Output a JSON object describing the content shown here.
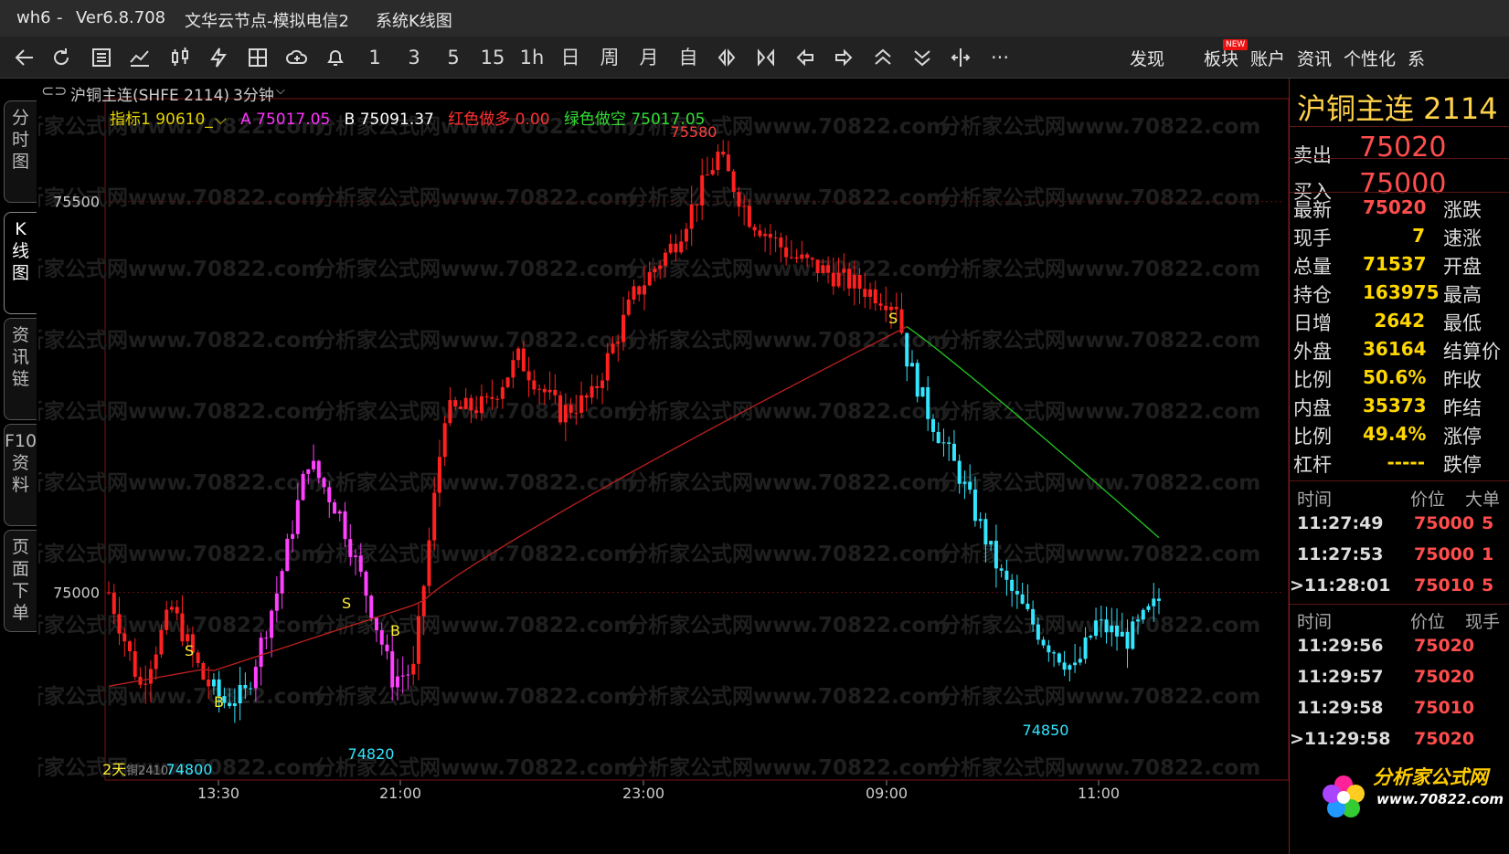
{
  "titlebar": {
    "app": "wh6",
    "separator": "-",
    "version": "Ver6.8.708",
    "server": "文华云节点-模拟电信2",
    "view": "系统K线图"
  },
  "toolbar": {
    "periods": [
      "1",
      "3",
      "5",
      "15",
      "1h",
      "日",
      "周",
      "月",
      "自"
    ],
    "discover": "发现",
    "new_badge": "NEW",
    "sector": "板块",
    "account": "账户",
    "news": "资讯",
    "personalize": "个性化",
    "system": "系"
  },
  "lefttabs": {
    "timeshare": "分时图",
    "kline": "K线图",
    "newschain": "资讯链",
    "f10": "F10资料",
    "pagedown": "页面下单"
  },
  "chart_header": {
    "contract": "沪铜主连(SHFE 2114)",
    "period": "3分钟"
  },
  "indicator": {
    "name": "指标1 90610_",
    "a_label": "A 75017.05",
    "b_label": "B 75091.37",
    "red_label": "红色做多 0.00",
    "green_label": "绿色做空 75017.05"
  },
  "chart_labels": {
    "high": "75580",
    "low1": "74800",
    "low2": "74820",
    "low3": "74850",
    "bottom_left": "2天",
    "bottom_contract": "铜2410",
    "watermark": "分析家公式网www.70822.com"
  },
  "chart_data": {
    "type": "candlestick",
    "y_ticks": [
      "75500",
      "75000"
    ],
    "x_ticks": [
      "13:30",
      "21:00",
      "23:00",
      "09:00",
      "11:00"
    ],
    "ylim": [
      74760,
      75620
    ],
    "high": 75580,
    "lows": [
      74800,
      74820,
      74850
    ],
    "signals": [
      "S",
      "B",
      "S",
      "B",
      "S"
    ]
  },
  "quote": {
    "title": "沪铜主连 2114",
    "sell_label": "卖出",
    "sell_price": "75020",
    "buy_label": "买入",
    "buy_price": "75000",
    "rows": [
      {
        "label": "最新",
        "value": "75020",
        "color": "#ff4d4d",
        "right": "涨跌"
      },
      {
        "label": "现手",
        "value": "7",
        "color": "#ffd700",
        "right": "速涨"
      },
      {
        "label": "总量",
        "value": "71537",
        "color": "#ffd700",
        "right": "开盘"
      },
      {
        "label": "持仓",
        "value": "163975",
        "color": "#ffd700",
        "right": "最高"
      },
      {
        "label": "日增",
        "value": "2642",
        "color": "#ffd700",
        "right": "最低"
      },
      {
        "label": "外盘",
        "value": "36164",
        "color": "#ffd700",
        "right": "结算价"
      },
      {
        "label": "比例",
        "value": "50.6%",
        "color": "#ffd700",
        "right": "昨收"
      },
      {
        "label": "内盘",
        "value": "35373",
        "color": "#ffd700",
        "right": "昨结"
      },
      {
        "label": "比例",
        "value": "49.4%",
        "color": "#ffd700",
        "right": "涨停"
      },
      {
        "label": "杠杆",
        "value": "-----",
        "color": "#ffd700",
        "right": "跌停"
      }
    ]
  },
  "ticks1": {
    "head_time": "时间",
    "head_price": "价位",
    "head_vol": "大单",
    "rows": [
      {
        "time": "11:27:49",
        "price": "75000",
        "vol": "5"
      },
      {
        "time": "11:27:53",
        "price": "75000",
        "vol": "1"
      },
      {
        "time": ">11:28:01",
        "price": "75010",
        "vol": "5"
      }
    ]
  },
  "ticks2": {
    "head_time": "时间",
    "head_price": "价位",
    "head_vol": "现手",
    "rows": [
      {
        "time": "11:29:56",
        "price": "75020"
      },
      {
        "time": "11:29:57",
        "price": "75020"
      },
      {
        "time": "11:29:58",
        "price": "75010"
      },
      {
        "time": ">11:29:58",
        "price": "75020"
      }
    ]
  },
  "logo": {
    "name": "分析家公式网",
    "url": "www.70822.com"
  }
}
